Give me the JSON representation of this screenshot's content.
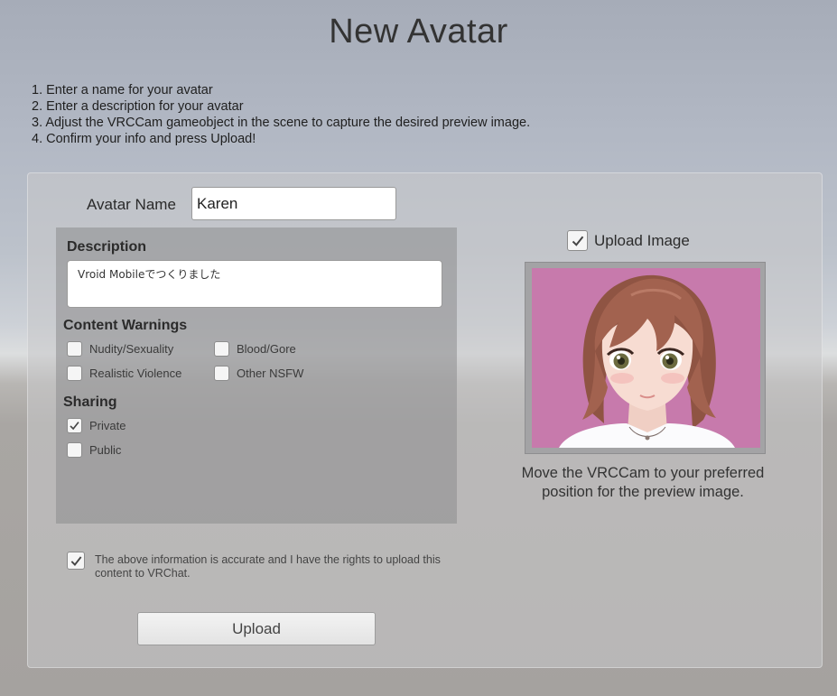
{
  "title": "New Avatar",
  "instructions": [
    "1. Enter a name for your avatar",
    "2. Enter a description for your avatar",
    "3. Adjust the VRCCam gameobject in the scene to capture the desired preview image.",
    "4. Confirm your info and press Upload!"
  ],
  "form": {
    "avatar_name_label": "Avatar Name",
    "avatar_name_value": "Karen",
    "description_label": "Description",
    "description_value": "Vroid Mobileでつくりました",
    "content_warnings_label": "Content Warnings",
    "content_warnings": [
      {
        "label": "Nudity/Sexuality",
        "checked": false
      },
      {
        "label": "Blood/Gore",
        "checked": false
      },
      {
        "label": "Realistic Violence",
        "checked": false
      },
      {
        "label": "Other NSFW",
        "checked": false
      }
    ],
    "sharing_label": "Sharing",
    "sharing": [
      {
        "label": "Private",
        "checked": true
      },
      {
        "label": "Public",
        "checked": false
      }
    ],
    "agreement_text": "The above information is accurate and I have the rights to upload this content to VRChat.",
    "agreement_checked": true,
    "upload_button": "Upload"
  },
  "preview": {
    "upload_image_label": "Upload Image",
    "upload_image_checked": true,
    "caption": "Move the VRCCam to your preferred position for the preview image."
  },
  "colors": {
    "preview_background": "#c77aac",
    "hair": "#a2624f",
    "skin": "#f7dcd2"
  }
}
